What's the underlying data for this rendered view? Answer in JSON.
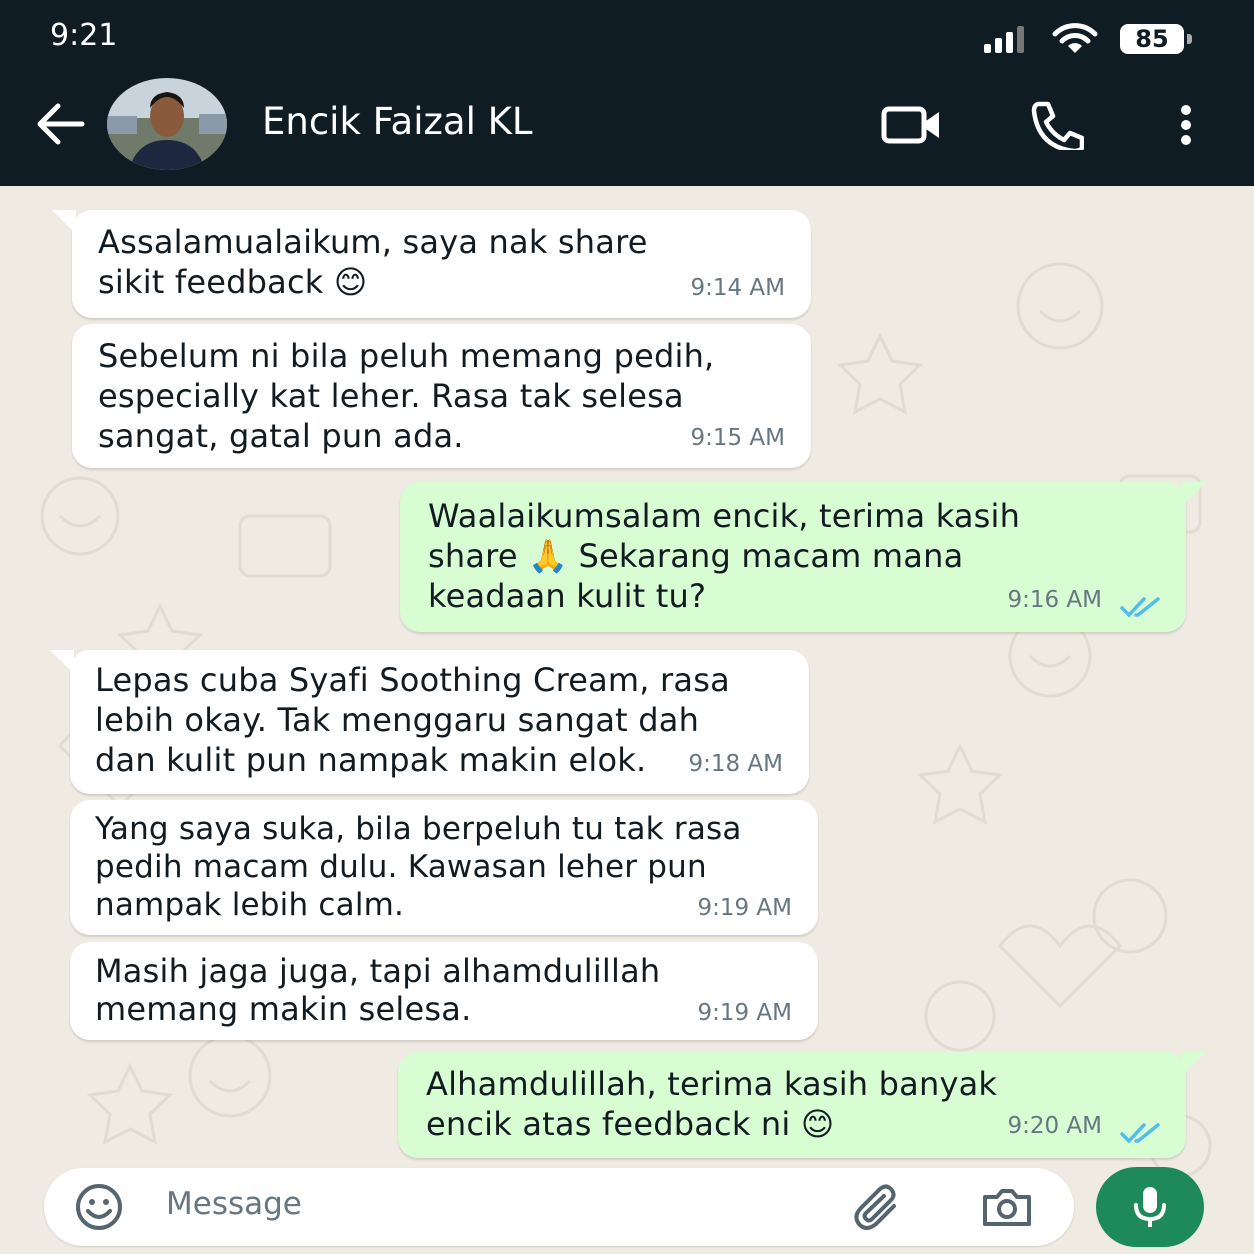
{
  "status_bar": {
    "time": "9:21",
    "battery": "85"
  },
  "header": {
    "contact_name": "Encik Faizal KL"
  },
  "messages": [
    {
      "direction": "incoming",
      "text": "Assalamualaikum, saya nak share\nsikit feedback 😊",
      "time": "9:14 AM"
    },
    {
      "direction": "incoming",
      "text": "Sebelum ni bila peluh memang pedih,\nespecially kat leher. Rasa tak selesa\nsangat, gatal pun ada.",
      "time": "9:15 AM"
    },
    {
      "direction": "outgoing",
      "text": "Waalaikumsalam encik, terima kasih\nshare 🙏 Sekarang macam mana\nkeadaan kulit tu?",
      "time": "9:16 AM",
      "status": "read"
    },
    {
      "direction": "incoming",
      "text": "Lepas cuba Syafi Soothing Cream, rasa\nlebih okay. Tak menggaru sangat dah\ndan kulit pun nampak makin elok.",
      "time": "9:18 AM"
    },
    {
      "direction": "incoming",
      "text": "Yang saya suka, bila berpeluh tu tak rasa\npedih macam dulu. Kawasan leher pun\nnampak lebih calm.",
      "time": "9:19 AM"
    },
    {
      "direction": "incoming",
      "text": "Masih jaga juga, tapi alhamdulillah\nmemang makin selesa.",
      "time": "9:19 AM"
    },
    {
      "direction": "outgoing",
      "text": "Alhamdulillah, terima kasih banyak\nencik atas feedback ni 😊",
      "time": "9:20 AM",
      "status": "read"
    }
  ],
  "composer": {
    "placeholder": "Message"
  },
  "colors": {
    "header_bg": "#0f1c24",
    "chat_bg": "#efeae2",
    "incoming_bubble": "#ffffff",
    "outgoing_bubble": "#d9fdd3",
    "read_tick": "#53bdeb",
    "mic_button": "#1f8a59"
  },
  "icons": [
    "back-arrow-icon",
    "video-call-icon",
    "phone-icon",
    "more-options-icon",
    "emoji-icon",
    "attach-icon",
    "camera-icon",
    "mic-icon",
    "signal-icon",
    "wifi-icon",
    "battery-icon",
    "double-tick-icon"
  ]
}
